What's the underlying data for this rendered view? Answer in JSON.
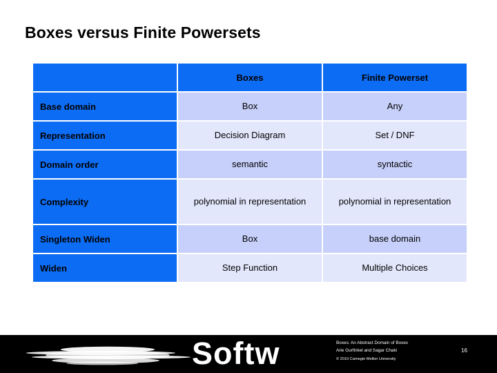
{
  "slide": {
    "title": "Boxes versus Finite Powersets",
    "page_number": "16"
  },
  "table": {
    "columns": [
      "",
      "Boxes",
      "Finite Powerset"
    ],
    "rows": [
      {
        "label": "Base domain",
        "boxes": "Box",
        "powerset": "Any"
      },
      {
        "label": "Representation",
        "boxes": "Decision Diagram",
        "powerset": "Set / DNF"
      },
      {
        "label": "Domain order",
        "boxes": "semantic",
        "powerset": "syntactic"
      },
      {
        "label": "Complexity",
        "boxes": "polynomial in representation",
        "powerset": "polynomial in representation"
      },
      {
        "label": "Singleton Widen",
        "boxes": "Box",
        "powerset": "base domain"
      },
      {
        "label": "Widen",
        "boxes": "Step Function",
        "powerset": "Multiple Choices"
      }
    ]
  },
  "footer": {
    "logo_wordmark": "Softw",
    "credit_title": "Boxes: An Abstract Domain of Boxes",
    "credit_authors": "Arie Gurfinkel and Sagar Chaki",
    "copyright": "© 2010 Carnegie Mellon University"
  },
  "colors": {
    "header_blue": "#0c6cf3",
    "row_shade_dark": "#c7d0fa",
    "row_shade_light": "#e3e7fc",
    "footer_background": "#000000",
    "page_background": "#ffffff"
  }
}
